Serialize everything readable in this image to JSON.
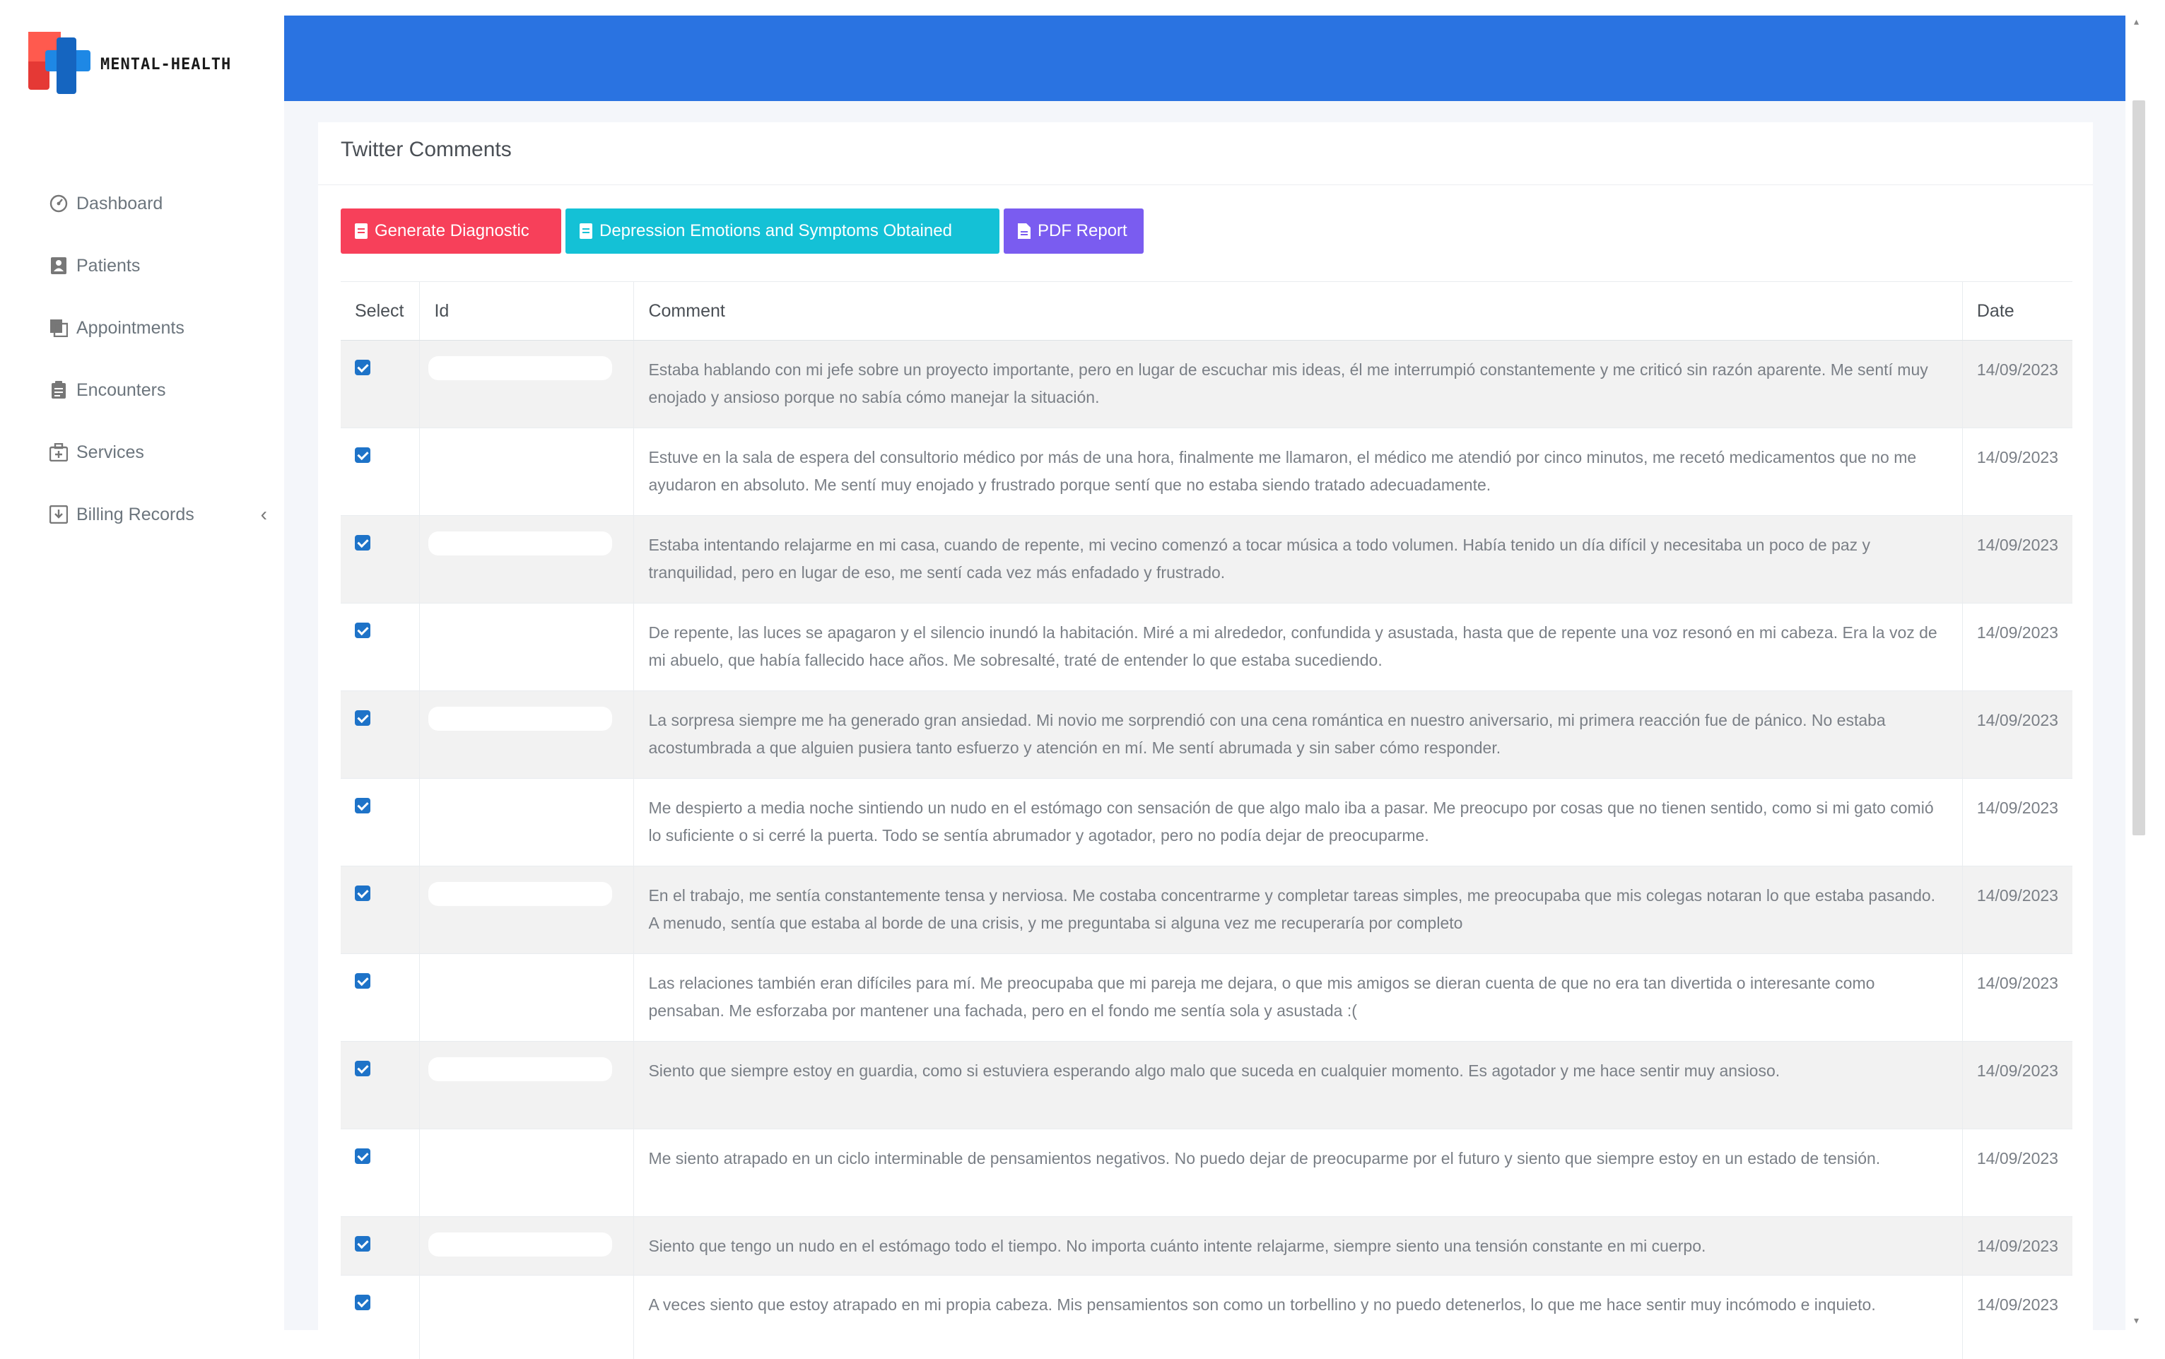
{
  "brand": {
    "name": "MENTAL-HEALTH"
  },
  "nav": [
    {
      "label": "Dashboard",
      "icon": "dashboard-icon"
    },
    {
      "label": "Patients",
      "icon": "patient-icon"
    },
    {
      "label": "Appointments",
      "icon": "appointments-icon"
    },
    {
      "label": "Encounters",
      "icon": "clipboard-icon"
    },
    {
      "label": "Services",
      "icon": "medical-bag-icon"
    },
    {
      "label": "Billing Records",
      "icon": "billing-icon",
      "chevron": "‹"
    }
  ],
  "page": {
    "title": "Twitter Comments"
  },
  "buttons": {
    "generate": "Generate Diagnostic",
    "emotions": "Depression Emotions and Symptoms Obtained",
    "pdf": "PDF Report"
  },
  "colors": {
    "topbar": "#2a73e1",
    "generate": "#f7405a",
    "emotions": "#14c1d6",
    "pdf": "#7a5cf0",
    "checkbox": "#1e73c8"
  },
  "table": {
    "headers": {
      "select": "Select",
      "id": "Id",
      "comment": "Comment",
      "date": "Date"
    },
    "rows": [
      {
        "checked": true,
        "comment": "Estaba hablando con mi jefe sobre un proyecto importante, pero en lugar de escuchar mis ideas, él me interrumpió constantemente y me criticó sin razón aparente. Me sentí muy enojado y ansioso porque no sabía cómo manejar la situación.",
        "date": "14/09/2023"
      },
      {
        "checked": true,
        "comment": "Estuve en la sala de espera del consultorio médico por más de una hora, finalmente me llamaron, el médico me atendió por cinco minutos, me recetó medicamentos que no me ayudaron en absoluto. Me sentí muy enojado y frustrado porque sentí que no estaba siendo tratado adecuadamente.",
        "date": "14/09/2023"
      },
      {
        "checked": true,
        "comment": "Estaba intentando relajarme en mi casa, cuando de repente, mi vecino comenzó a tocar música a todo volumen. Había tenido un día difícil y necesitaba un poco de paz y tranquilidad, pero en lugar de eso, me sentí cada vez más enfadado y frustrado.",
        "date": "14/09/2023"
      },
      {
        "checked": true,
        "comment": "De repente, las luces se apagaron y el silencio inundó la habitación. Miré a mi alrededor, confundida y asustada, hasta que de repente una voz resonó en mi cabeza. Era la voz de mi abuelo, que había fallecido hace años. Me sobresalté, traté de entender lo que estaba sucediendo.",
        "date": "14/09/2023"
      },
      {
        "checked": true,
        "comment": "La sorpresa siempre me ha generado gran ansiedad. Mi novio me sorprendió con una cena romántica en nuestro aniversario, mi primera reacción fue de pánico. No estaba acostumbrada a que alguien pusiera tanto esfuerzo y atención en mí. Me sentí abrumada y sin saber cómo responder.",
        "date": "14/09/2023"
      },
      {
        "checked": true,
        "comment": "Me despierto a media noche sintiendo un nudo en el estómago con sensación de que algo malo iba a pasar. Me preocupo por cosas que no tienen sentido, como si mi gato comió lo suficiente o si cerré la puerta. Todo se sentía abrumador y agotador, pero no podía dejar de preocuparme.",
        "date": "14/09/2023"
      },
      {
        "checked": true,
        "comment": "En el trabajo, me sentía constantemente tensa y nerviosa. Me costaba concentrarme y completar tareas simples, me preocupaba que mis colegas notaran lo que estaba pasando. A menudo, sentía que estaba al borde de una crisis, y me preguntaba si alguna vez me recuperaría por completo",
        "date": "14/09/2023"
      },
      {
        "checked": true,
        "comment": "Las relaciones también eran difíciles para mí. Me preocupaba que mi pareja me dejara, o que mis amigos se dieran cuenta de que no era tan divertida o interesante como pensaban. Me esforzaba por mantener una fachada, pero en el fondo me sentía sola y asustada :(",
        "date": "14/09/2023"
      },
      {
        "checked": true,
        "comment": "Siento que siempre estoy en guardia, como si estuviera esperando algo malo que suceda en cualquier momento. Es agotador y me hace sentir muy ansioso.",
        "date": "14/09/2023"
      },
      {
        "checked": true,
        "comment": "Me siento atrapado en un ciclo interminable de pensamientos negativos. No puedo dejar de preocuparme por el futuro y siento que siempre estoy en un estado de tensión.",
        "date": "14/09/2023"
      },
      {
        "checked": true,
        "comment": "Siento que tengo un nudo en el estómago todo el tiempo. No importa cuánto intente relajarme, siempre siento una tensión constante en mi cuerpo.",
        "date": "14/09/2023"
      },
      {
        "checked": true,
        "comment": "A veces siento que estoy atrapado en mi propia cabeza. Mis pensamientos son como un torbellino y no puedo detenerlos, lo que me hace sentir muy incómodo e inquieto.",
        "date": "14/09/2023"
      }
    ]
  }
}
